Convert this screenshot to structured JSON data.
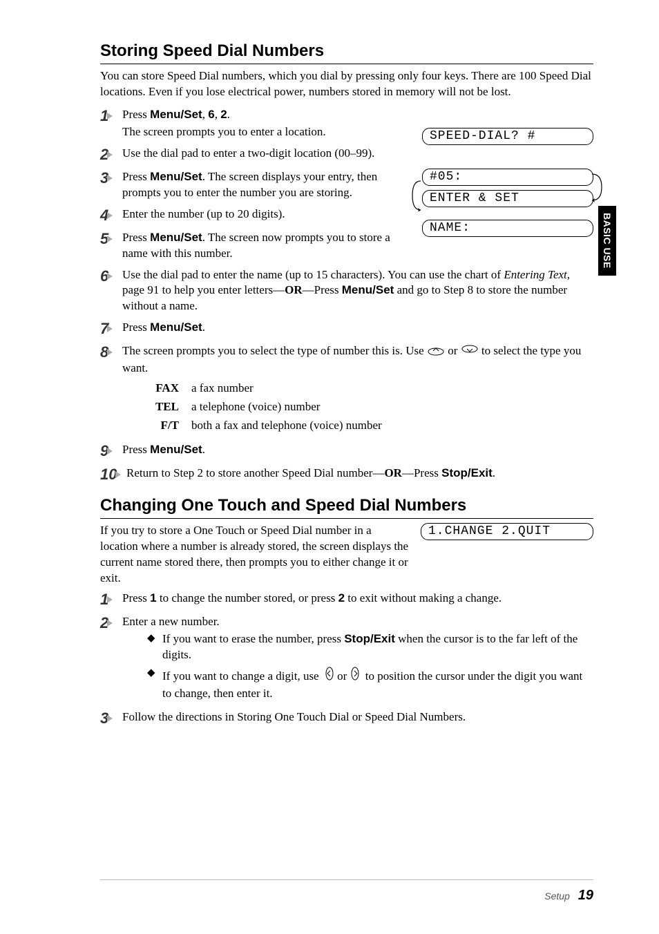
{
  "tab": "BASIC USE",
  "sec1": {
    "title": "Storing Speed Dial Numbers",
    "intro": "You can store Speed Dial numbers, which you dial by pressing only four keys. There are 100 Speed Dial locations. Even if you lose electrical power, numbers stored in memory will not be lost.",
    "s1a": "Press ",
    "s1b": "Menu/Set",
    "s1c": ", ",
    "s1d": "6",
    "s1e": ", ",
    "s1f": "2",
    "s1g": ".",
    "s1sub": "The screen prompts you to enter a location.",
    "s2": "Use the dial pad to enter a two-digit location (00–99).",
    "s3a": "Press ",
    "s3b": "Menu/Set",
    "s3c": ". The screen displays your entry, then prompts you to enter the number you are storing.",
    "s4": "Enter the number (up to 20 digits).",
    "s5a": "Press ",
    "s5b": "Menu/Set",
    "s5c": ". The screen now prompts you to store a name with this number.",
    "s6a": "Use the dial pad to enter the name (up to 15 characters). You can use the chart of ",
    "s6b": "Entering Text",
    "s6c": ", page 91 to help you enter letters—",
    "s6d": "OR",
    "s6e": "—Press ",
    "s6f": "Menu/Set",
    "s6g": " and go to Step 8 to store the number without a name.",
    "s7a": "Press ",
    "s7b": "Menu/Set",
    "s7c": ".",
    "s8a": "The screen prompts you to select the type of number this is. Use ",
    "s8b": " or ",
    "s8c": " to select the type you want.",
    "def": [
      {
        "k": "FAX",
        "v": "a fax number"
      },
      {
        "k": "TEL",
        "v": "a telephone (voice) number"
      },
      {
        "k": "F/T",
        "v": "both a fax and telephone (voice) number"
      }
    ],
    "s9a": "Press ",
    "s9b": "Menu/Set",
    "s9c": ".",
    "s10a": "Return to Step 2 to store another Speed Dial number—",
    "s10b": "OR",
    "s10c": "—Press ",
    "s10d": "Stop/Exit",
    "s10e": ".",
    "lcd1": "SPEED-DIAL? #",
    "lcd2": "#05:",
    "lcd3": "ENTER & SET",
    "lcd4": "NAME:"
  },
  "sec2": {
    "title": "Changing One Touch and Speed Dial Numbers",
    "intro": "If you try to store a One Touch or Speed Dial number in a location where a number is already stored, the screen displays the current name stored there, then prompts you to either change it or exit.",
    "lcd": "1.CHANGE 2.QUIT",
    "s1a": "Press ",
    "s1b": "1",
    "s1c": " to change the number stored, or press ",
    "s1d": "2",
    "s1e": " to exit without making a change.",
    "s2": "Enter a new number.",
    "b1a": "If you want to erase the number, press ",
    "b1b": "Stop/Exit",
    "b1c": " when the cursor is to the far left of the digits.",
    "b2a": "If you want to change a digit, use ",
    "b2b": " or ",
    "b2c": " to position the cursor under the digit you want to change, then enter it.",
    "s3": "Follow the directions in Storing One Touch Dial or Speed Dial Numbers."
  },
  "footer": {
    "section": "Setup",
    "page": "19"
  }
}
